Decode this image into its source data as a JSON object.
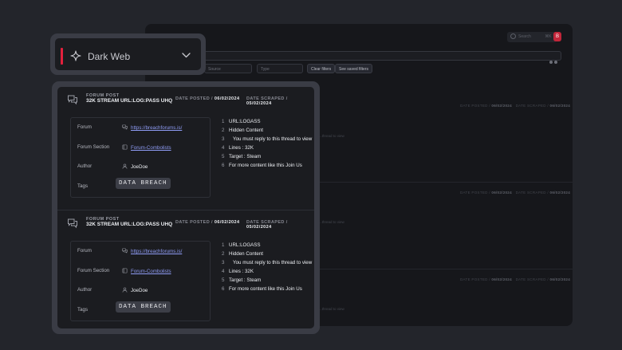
{
  "background_app": {
    "search_placeholder": "Search",
    "search_hint": "⌘K",
    "avatar_initial": "B",
    "dropdowns": [
      "Source",
      "Type"
    ],
    "clear_filters": "Clear filters",
    "saved_filters": "See saved filters",
    "rows": [
      {
        "posted_label": "DATE POSTED /",
        "posted": "06/02/2024",
        "scraped_label": "DATE SCRAPED /",
        "scraped": "06/02/2024",
        "snippet": "...thread to view"
      },
      {
        "posted_label": "DATE POSTED /",
        "posted": "06/02/2024",
        "scraped_label": "DATE SCRAPED /",
        "scraped": "06/02/2024",
        "snippet": "...thread to view"
      },
      {
        "posted_label": "DATE POSTED /",
        "posted": "06/02/2024",
        "scraped_label": "DATE SCRAPED /",
        "scraped": "06/02/2024",
        "snippet": "...thread to view"
      }
    ]
  },
  "selector": {
    "label": "Dark Web",
    "icon": "sparkle-icon",
    "accent_color": "#e3213d"
  },
  "posts": [
    {
      "type": "FORUM POST",
      "title": "32K STREAM URL:LOG:PASS UHQ",
      "posted_label": "DATE POSTED /",
      "posted": "06/02/2024",
      "scraped_label": "DATE SCRAPED /",
      "scraped": "05/02/2024",
      "forum_label": "Forum",
      "forum": "https://breachforums.is/",
      "section_label": "Forum Section",
      "section": "Forum-Combolists",
      "author_label": "Author",
      "author": "JoeDoe",
      "tags_label": "Tags",
      "tag": "DATA BREACH",
      "lines": [
        {
          "n": "1",
          "text": "URL:LOGASS"
        },
        {
          "n": "2",
          "text": "Hidden Content"
        },
        {
          "n": "3",
          "text": "   You must reply to this thread to view"
        },
        {
          "n": "4",
          "text": "Lines : 32K"
        },
        {
          "n": "5",
          "text": "Target : Steam"
        },
        {
          "n": "6",
          "text": "For more content like this Join Us"
        }
      ]
    },
    {
      "type": "FORUM POST",
      "title": "32K STREAM URL:LOG:PASS UHQ",
      "posted_label": "DATE POSTED /",
      "posted": "06/02/2024",
      "scraped_label": "DATE SCRAPED /",
      "scraped": "05/02/2024",
      "forum_label": "Forum",
      "forum": "https://breachforums.is/",
      "section_label": "Forum Section",
      "section": "Forum-Combolists",
      "author_label": "Author",
      "author": "JoeDoe",
      "tags_label": "Tags",
      "tag": "DATA BREACH",
      "lines": [
        {
          "n": "1",
          "text": "URL:LOGASS"
        },
        {
          "n": "2",
          "text": "Hidden Content"
        },
        {
          "n": "3",
          "text": "   You must reply to this thread to view"
        },
        {
          "n": "4",
          "text": "Lines : 32K"
        },
        {
          "n": "5",
          "text": "Target : Steam"
        },
        {
          "n": "6",
          "text": "For more content like this Join Us"
        }
      ]
    }
  ]
}
